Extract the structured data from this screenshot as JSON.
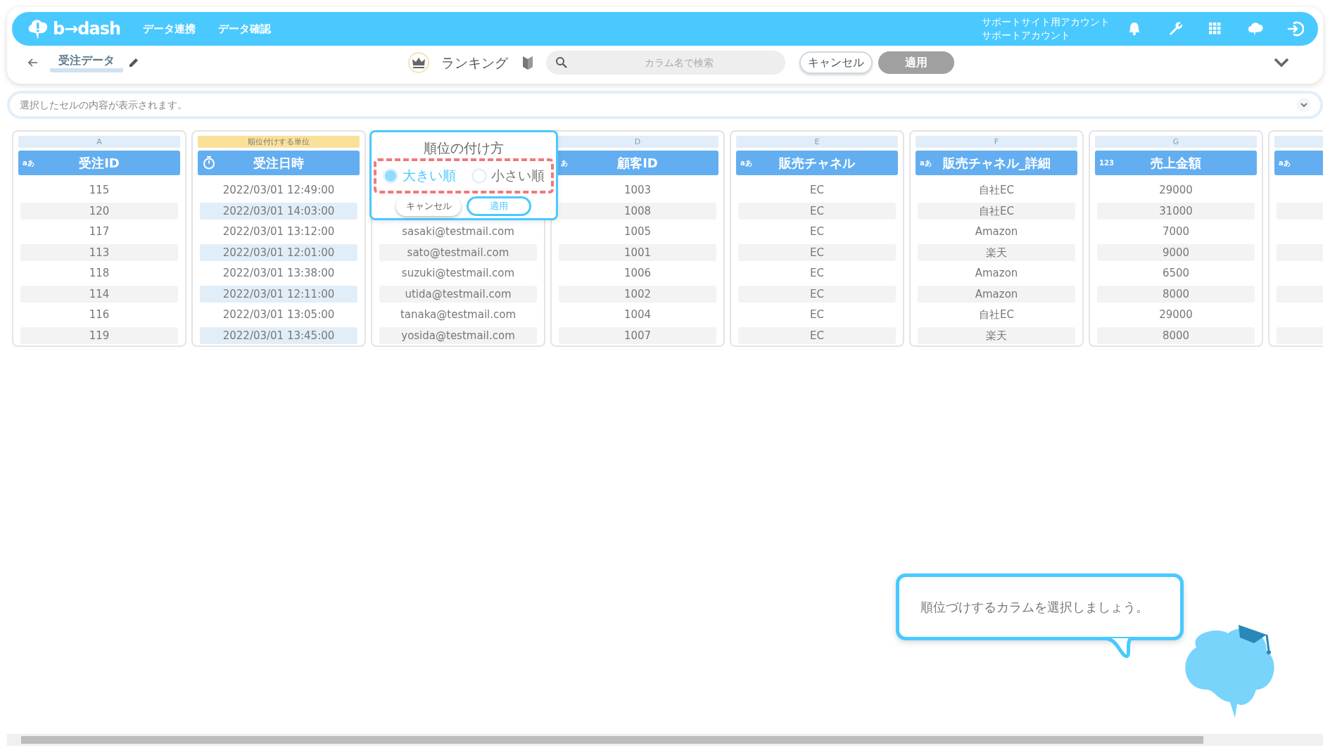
{
  "navbar": {
    "logo": "b→dash",
    "items": [
      "データ連携",
      "データ確認"
    ],
    "account": [
      "サポートサイト用アカウント",
      "サポートアカウント"
    ]
  },
  "toolbar": {
    "title": "受注データ",
    "mode": "ランキング",
    "search": {
      "placeholder": "カラム名で検索"
    },
    "cancel": "キャンセル",
    "apply": {
      "label": "適用",
      "disabled": true
    }
  },
  "cell_bar": {
    "placeholder": "選択したセルの内容が表示されます。"
  },
  "columns": [
    {
      "label": "A",
      "highlighted": false,
      "kind": "text",
      "type_label": "aあ",
      "name": "受注ID",
      "selected": false,
      "cells": [
        "115",
        "120",
        "117",
        "113",
        "118",
        "114",
        "116",
        "119"
      ]
    },
    {
      "label": "順位付けする単位",
      "highlighted": true,
      "kind": "datetime",
      "name": "受注日時",
      "selected": true,
      "cells": [
        "2022/03/01 12:49:00",
        "2022/03/01 14:03:00",
        "2022/03/01 13:12:00",
        "2022/03/01 12:01:00",
        "2022/03/01 13:38:00",
        "2022/03/01 12:11:00",
        "2022/03/01 13:05:00",
        "2022/03/01 13:45:00"
      ]
    },
    {
      "kind": "covered",
      "selected": false,
      "cells": [
        "sasaki@testmail.com",
        "sato@testmail.com",
        "suzuki@testmail.com",
        "utida@testmail.com",
        "tanaka@testmail.com",
        "yosida@testmail.com"
      ]
    },
    {
      "label": "D",
      "highlighted": false,
      "kind": "text",
      "type_label": "あ",
      "name": "顧客ID",
      "selected": false,
      "cells": [
        "1003",
        "1008",
        "1005",
        "1001",
        "1006",
        "1002",
        "1004",
        "1007"
      ]
    },
    {
      "label": "E",
      "highlighted": false,
      "kind": "text",
      "type_label": "aあ",
      "name": "販売チャネル",
      "selected": false,
      "cells": [
        "EC",
        "EC",
        "EC",
        "EC",
        "EC",
        "EC",
        "EC",
        "EC"
      ]
    },
    {
      "label": "F",
      "highlighted": false,
      "kind": "text",
      "type_label": "aあ",
      "name": "販売チャネル_詳細",
      "selected": false,
      "cells": [
        "自社EC",
        "自社EC",
        "Amazon",
        "楽天",
        "Amazon",
        "Amazon",
        "自社EC",
        "楽天"
      ]
    },
    {
      "label": "G",
      "highlighted": false,
      "kind": "number",
      "type_label": "123",
      "name": "売上金額",
      "selected": false,
      "cells": [
        "29000",
        "31000",
        "7000",
        "9000",
        "6500",
        "8000",
        "29000",
        "8000"
      ]
    },
    {
      "kind": "text",
      "type_label": "aあ",
      "selected": false
    }
  ],
  "popup": {
    "title": "順位の付け方",
    "options": [
      {
        "label": "大きい順",
        "selected": true
      },
      {
        "label": "小さい順",
        "selected": false
      }
    ],
    "cancel": "キャンセル",
    "apply": "適用"
  },
  "hint": {
    "text": "順位づけするカラムを選択しましょう。"
  }
}
